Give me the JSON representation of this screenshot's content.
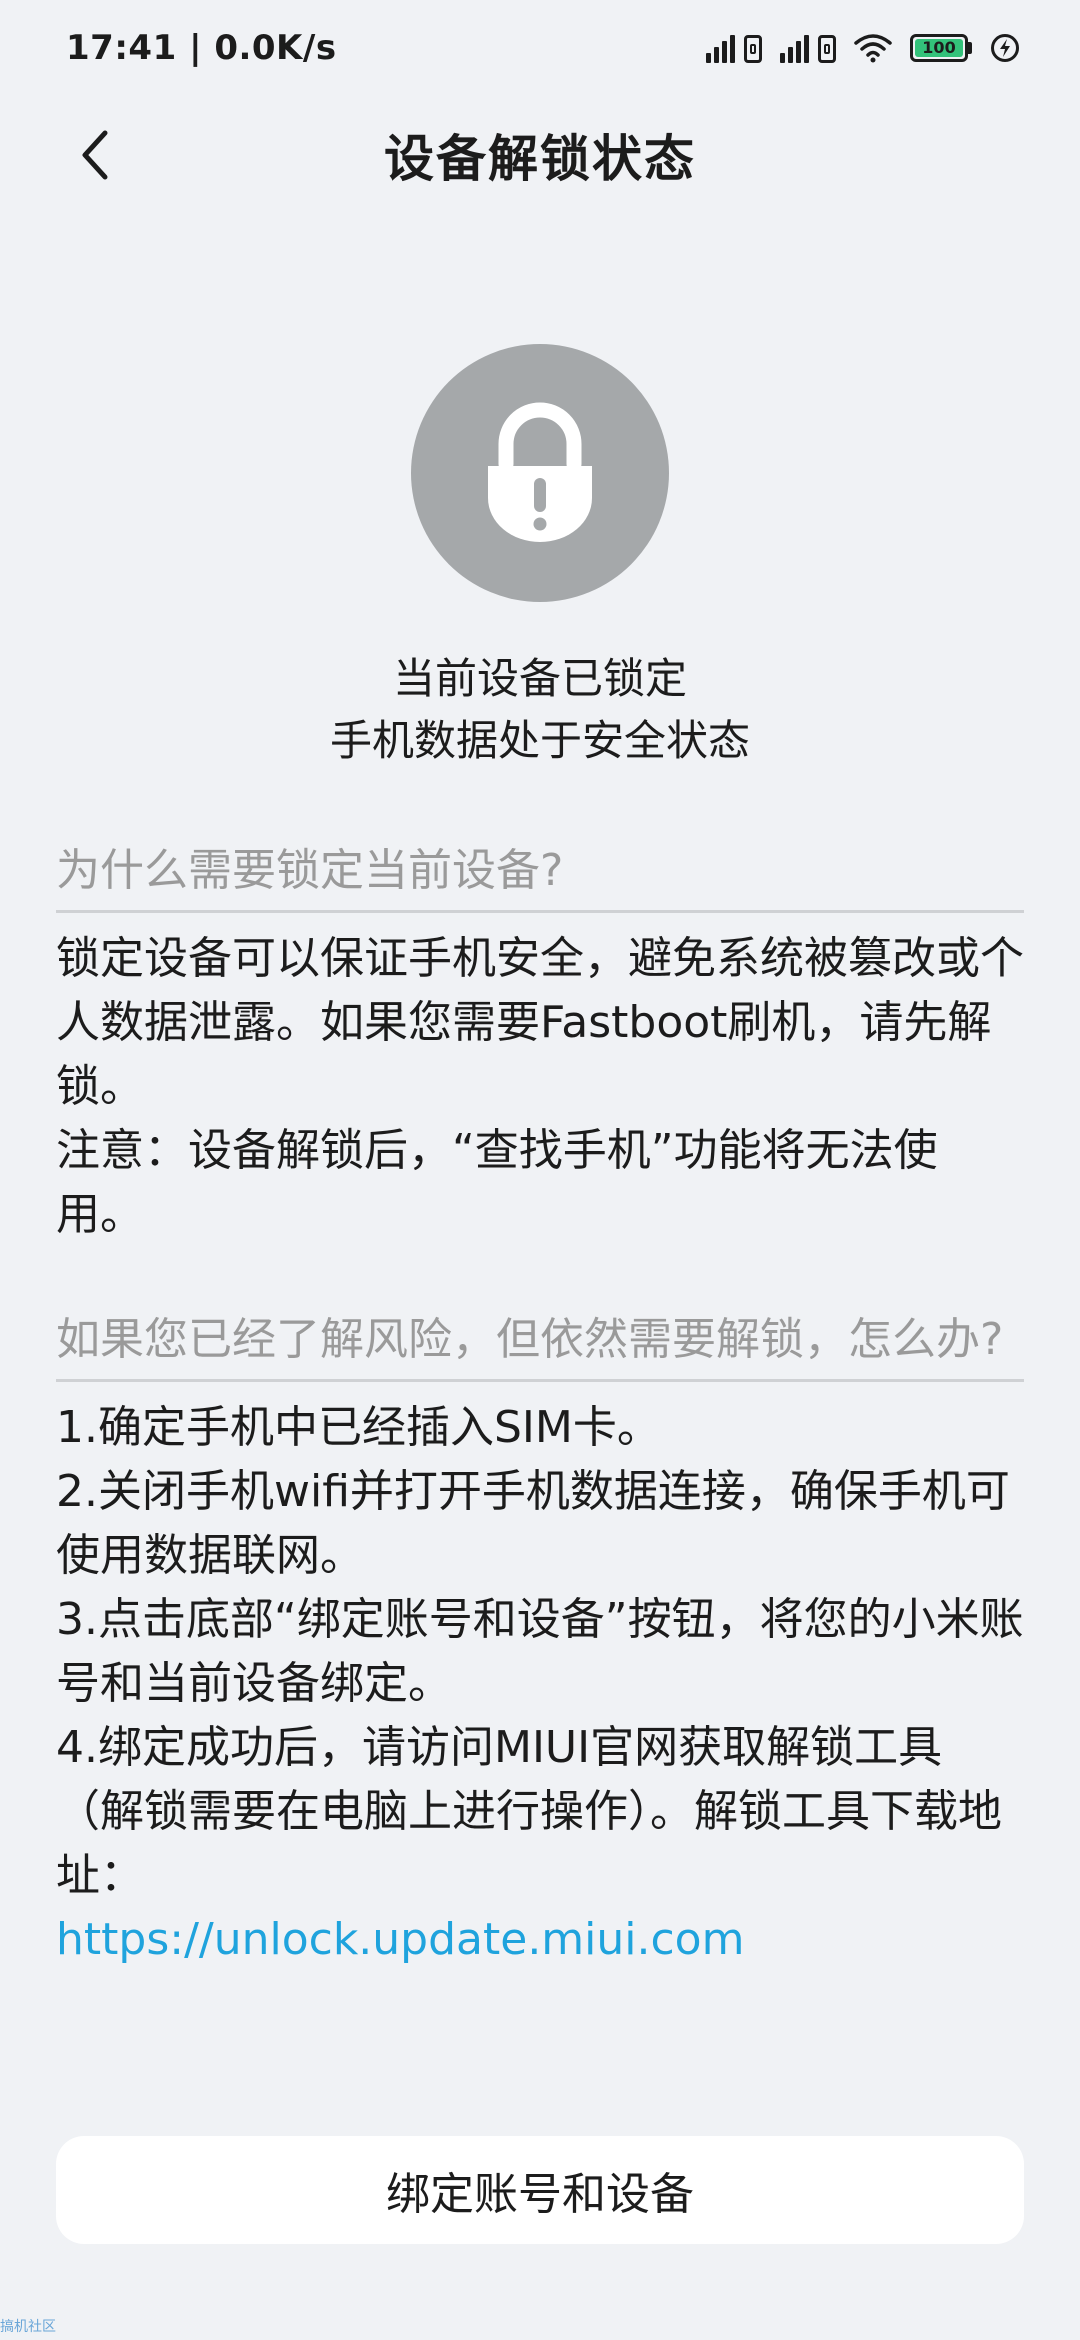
{
  "status_bar": {
    "time": "17:41",
    "separator": " | ",
    "net_speed": "0.0K/s",
    "battery_level": "100"
  },
  "header": {
    "title": "设备解锁状态"
  },
  "lock_status": {
    "line1": "当前设备已锁定",
    "line2": "手机数据处于安全状态"
  },
  "section1": {
    "heading": "为什么需要锁定当前设备?",
    "paragraph1": "锁定设备可以保证手机安全，避免系统被篡改或个人数据泄露。如果您需要Fastboot刷机，请先解锁。",
    "paragraph2": "注意：设备解锁后，“查找手机”功能将无法使用。"
  },
  "section2": {
    "heading": "如果您已经了解风险，但依然需要解锁，怎么办?",
    "steps": [
      "1.确定手机中已经插入SIM卡。",
      "2.关闭手机wifi并打开手机数据连接，确保手机可使用数据联网。",
      "3.点击底部“绑定账号和设备”按钮，将您的小米账号和当前设备绑定。",
      "4.绑定成功后，请访问MIUI官网获取解锁工具（解锁需要在电脑上进行操作）。解锁工具下载地址："
    ],
    "link": "https://unlock.update.miui.com"
  },
  "bind_button": {
    "label": "绑定账号和设备"
  },
  "watermark": "搞机社区",
  "colors": {
    "background": "#f0f2f5",
    "lock_circle": "#a5a8aa",
    "link": "#1fa3dd",
    "battery": "#33c27a"
  }
}
